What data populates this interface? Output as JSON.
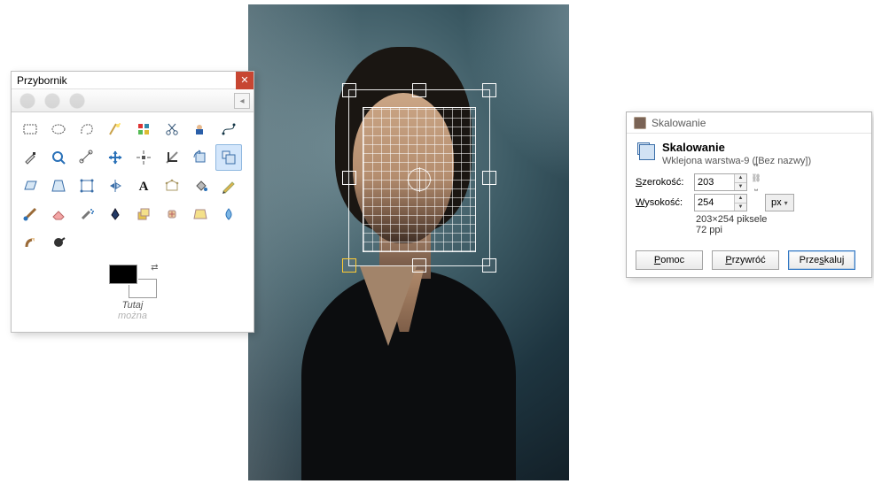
{
  "toolbox": {
    "title": "Przybornik",
    "footer_line1": "Tutaj",
    "footer_line2": "można",
    "tools": [
      {
        "name": "rect-select-icon"
      },
      {
        "name": "ellipse-select-icon"
      },
      {
        "name": "free-select-icon"
      },
      {
        "name": "fuzzy-select-icon"
      },
      {
        "name": "by-color-select-icon"
      },
      {
        "name": "scissors-select-icon"
      },
      {
        "name": "foreground-select-icon"
      },
      {
        "name": "paths-icon"
      },
      {
        "name": "color-picker-icon"
      },
      {
        "name": "zoom-icon"
      },
      {
        "name": "measure-icon"
      },
      {
        "name": "move-icon"
      },
      {
        "name": "align-icon"
      },
      {
        "name": "crop-icon"
      },
      {
        "name": "rotate-icon"
      },
      {
        "name": "scale-icon",
        "active": true
      },
      {
        "name": "shear-icon"
      },
      {
        "name": "perspective-icon"
      },
      {
        "name": "unified-transform-icon"
      },
      {
        "name": "flip-icon"
      },
      {
        "name": "text-icon"
      },
      {
        "name": "cage-icon"
      },
      {
        "name": "bucket-fill-icon"
      },
      {
        "name": "pencil-icon"
      },
      {
        "name": "paintbrush-icon"
      },
      {
        "name": "eraser-icon"
      },
      {
        "name": "airbrush-icon"
      },
      {
        "name": "ink-icon"
      },
      {
        "name": "clone-icon"
      },
      {
        "name": "heal-icon"
      },
      {
        "name": "perspective-clone-icon"
      },
      {
        "name": "blur-icon"
      },
      {
        "name": "smudge-icon"
      },
      {
        "name": "dodge-icon"
      }
    ],
    "colors": {
      "fg": "#000000",
      "bg": "#ffffff"
    }
  },
  "scale_dialog": {
    "window_title": "Skalowanie",
    "heading": "Skalowanie",
    "subheading": "Wklejona warstwa-9 ([Bez nazwy])",
    "width_label": "Szerokość:",
    "height_label": "Wysokość:",
    "width_value": "203",
    "height_value": "254",
    "width_underline": "S",
    "height_underline": "W",
    "unit_label": "px",
    "dims_line": "203×254 piksele",
    "ppi_line": "72 ppi",
    "btn_help": "Pomoc",
    "btn_help_u": "P",
    "btn_reset": "Przywróć",
    "btn_reset_u": "P",
    "btn_scale": "Przeskaluj",
    "btn_scale_u": "s"
  },
  "chart_data": {
    "type": "table",
    "title": "Skalowanie",
    "rows": [
      {
        "label": "Szerokość",
        "value": 203,
        "unit": "px"
      },
      {
        "label": "Wysokość",
        "value": 254,
        "unit": "px"
      }
    ],
    "resolution_ppi": 72,
    "pixel_dims": "203×254"
  }
}
